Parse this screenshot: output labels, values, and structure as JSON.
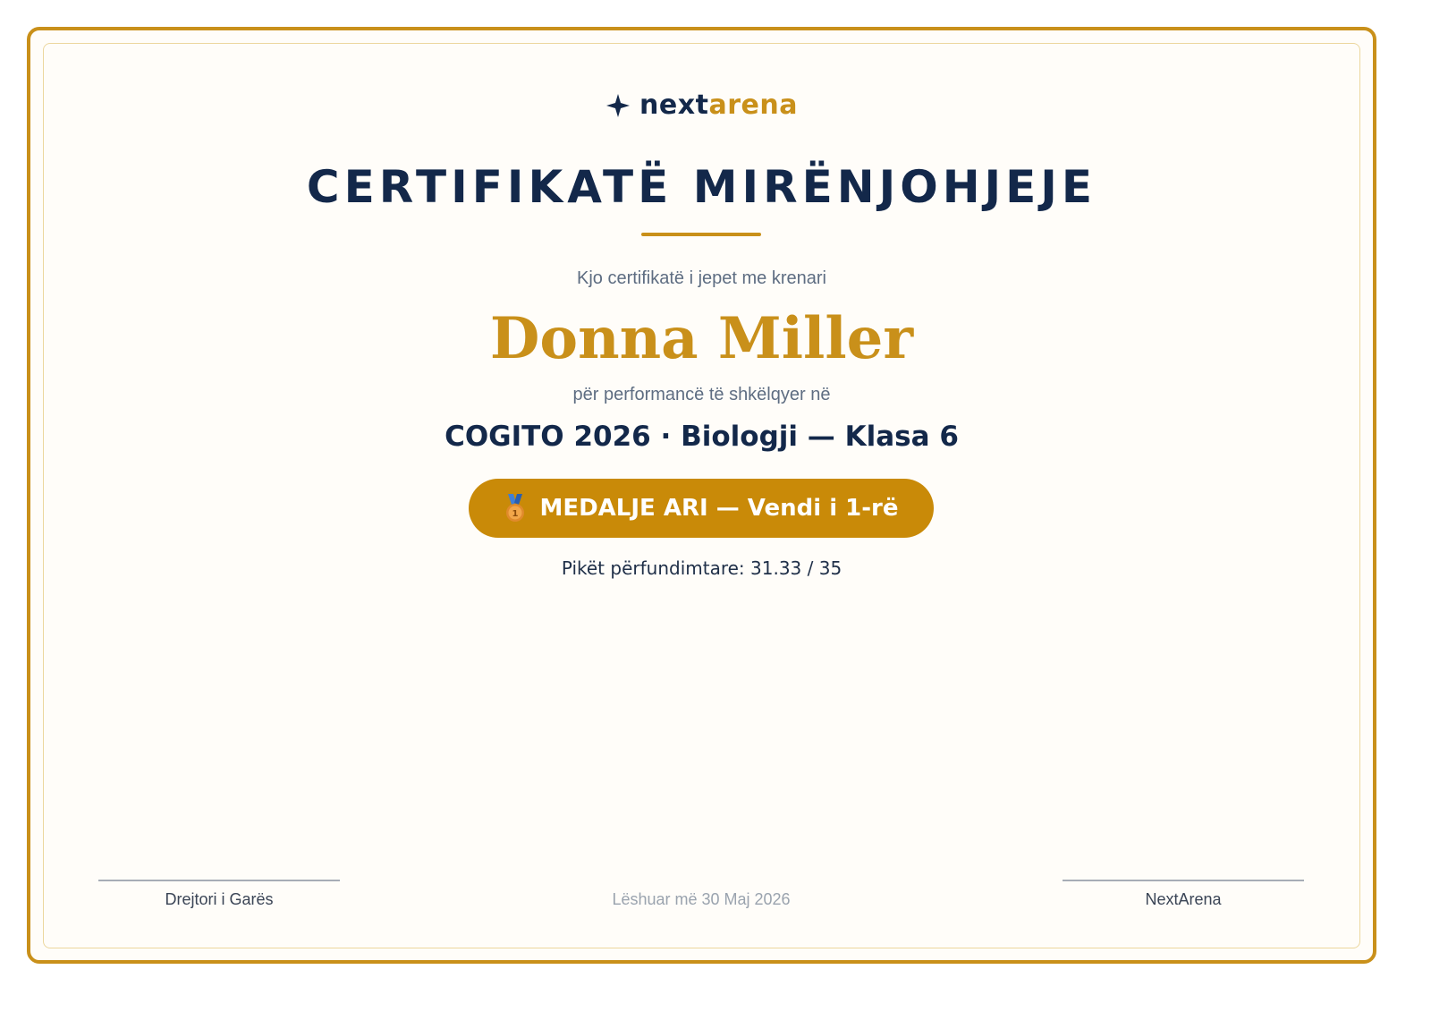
{
  "brand": {
    "name_part1": "next",
    "name_part2": "arena",
    "icon": "sparkle-star-icon",
    "primary_color": "#13284a",
    "accent_color": "#c9901a"
  },
  "certificate": {
    "title": "CERTIFIKATË MIRËNJOHJEJE",
    "presented_text": "Kjo certifikatë i jepet me krenari",
    "recipient_name": "Donna Miller",
    "for_text": "për performancë të shkëlqyer në",
    "event": "COGITO 2026 · Biologji — Klasa 6",
    "medal": {
      "icon": "gold-medal-icon",
      "label": "MEDALJE ARI — Vendi i 1-rë",
      "color": "#c98a08"
    },
    "score_text": "Pikët përfundimtare: 31.33 / 35"
  },
  "footer": {
    "left_signature": "Drejtori i Garës",
    "issued_text": "Lëshuar më 30 Maj 2026",
    "right_signature": "NextArena"
  },
  "colors": {
    "frame": "#c9901a",
    "background": "#fffdf9"
  }
}
